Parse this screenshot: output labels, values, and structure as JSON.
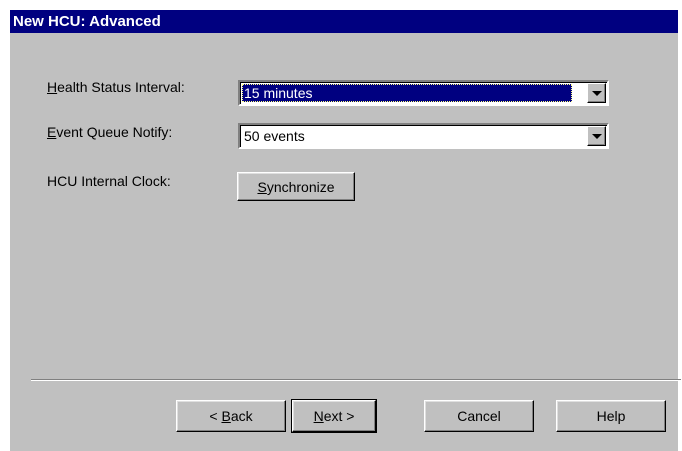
{
  "window": {
    "title": "New HCU: Advanced"
  },
  "form": {
    "health_status": {
      "label_mnemonic": "H",
      "label_rest": "ealth Status Interval:",
      "value": "15 minutes"
    },
    "event_queue": {
      "label_mnemonic": "E",
      "label_rest": "vent Queue Notify:",
      "value": "50 events"
    },
    "clock": {
      "label": "HCU Internal Clock:",
      "button_mnemonic": "S",
      "button_rest": "ynchronize"
    }
  },
  "footer": {
    "back_prefix": "< ",
    "back_mnemonic": "B",
    "back_rest": "ack",
    "next_mnemonic": "N",
    "next_rest": "ext >",
    "cancel": "Cancel",
    "help": "Help"
  },
  "colors": {
    "title_bar": "#000080",
    "dialog_face": "#c0c0c0",
    "selection": "#000080"
  },
  "icons": {
    "dropdown_arrow": "chevron-down-icon"
  }
}
